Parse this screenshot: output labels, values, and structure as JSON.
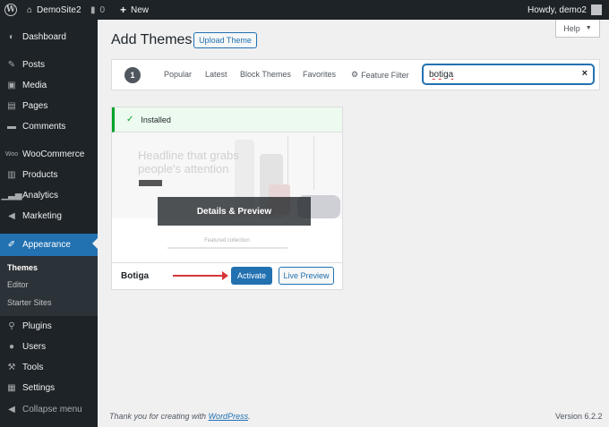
{
  "adminbar": {
    "site_name": "DemoSite2",
    "comments_count": "0",
    "new_label": "New",
    "howdy": "Howdy, demo2"
  },
  "sidebar": {
    "items": [
      {
        "label": "Dashboard",
        "icon": "dashboard-icon"
      },
      {
        "label": "Posts",
        "icon": "pin-icon"
      },
      {
        "label": "Media",
        "icon": "media-icon"
      },
      {
        "label": "Pages",
        "icon": "pages-icon"
      },
      {
        "label": "Comments",
        "icon": "comment-icon"
      },
      {
        "label": "WooCommerce",
        "icon": "woo-icon"
      },
      {
        "label": "Products",
        "icon": "archive-icon"
      },
      {
        "label": "Analytics",
        "icon": "chart-icon"
      },
      {
        "label": "Marketing",
        "icon": "megaphone-icon"
      },
      {
        "label": "Appearance",
        "icon": "brush-icon"
      },
      {
        "label": "Plugins",
        "icon": "plugin-icon"
      },
      {
        "label": "Users",
        "icon": "user-icon"
      },
      {
        "label": "Tools",
        "icon": "wrench-icon"
      },
      {
        "label": "Settings",
        "icon": "settings-icon"
      },
      {
        "label": "Collapse menu",
        "icon": "collapse-icon"
      }
    ],
    "submenu": [
      "Themes",
      "Editor",
      "Starter Sites"
    ]
  },
  "header": {
    "title": "Add Themes",
    "upload_label": "Upload Theme",
    "help_label": "Help"
  },
  "filters": {
    "count": "1",
    "tabs": [
      "Popular",
      "Latest",
      "Block Themes",
      "Favorites"
    ],
    "feature_filter": "Feature Filter",
    "search_value": "botiga",
    "clear": "×"
  },
  "theme": {
    "notice": "Installed",
    "screenshot_headline": "Headline that grabs people's attention",
    "screenshot_section": "Featured collection",
    "overlay": "Details & Preview",
    "name": "Botiga",
    "activate": "Activate",
    "preview": "Live Preview"
  },
  "footer": {
    "thanks_prefix": "Thank you for creating with ",
    "thanks_link": "WordPress",
    "thanks_suffix": ".",
    "version": "Version 6.2.2"
  }
}
